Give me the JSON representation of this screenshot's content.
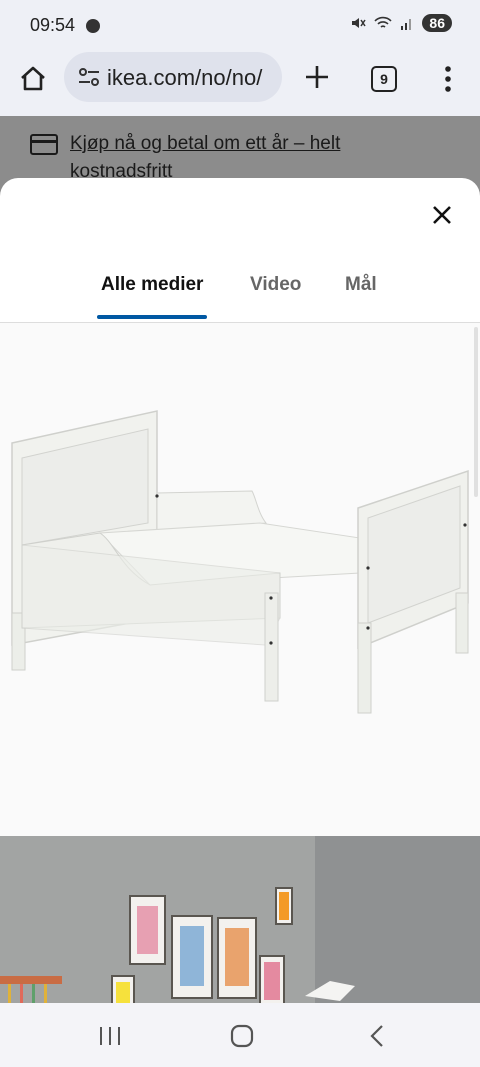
{
  "status": {
    "time": "09:54",
    "battery": "86"
  },
  "browser": {
    "url": "ikea.com/no/no/",
    "tab_count": "9"
  },
  "background": {
    "promo_text": "Kjøp nå og betal om ett år – helt",
    "promo_text_2": "kostnadsfritt"
  },
  "modal": {
    "tabs": [
      {
        "label": "Alle medier",
        "active": true
      },
      {
        "label": "Video",
        "active": false
      },
      {
        "label": "Mål",
        "active": false
      }
    ]
  },
  "icons": {
    "home": "home-icon",
    "tune": "site-settings-icon",
    "plus": "new-tab-icon",
    "tabs": "tab-switcher-icon",
    "menu": "more-vert-icon",
    "close": "close-icon",
    "card": "credit-card-icon",
    "recent": "recent-apps-icon",
    "navhome": "home-nav-icon",
    "back": "back-icon"
  },
  "colors": {
    "accent": "#0058a3"
  }
}
